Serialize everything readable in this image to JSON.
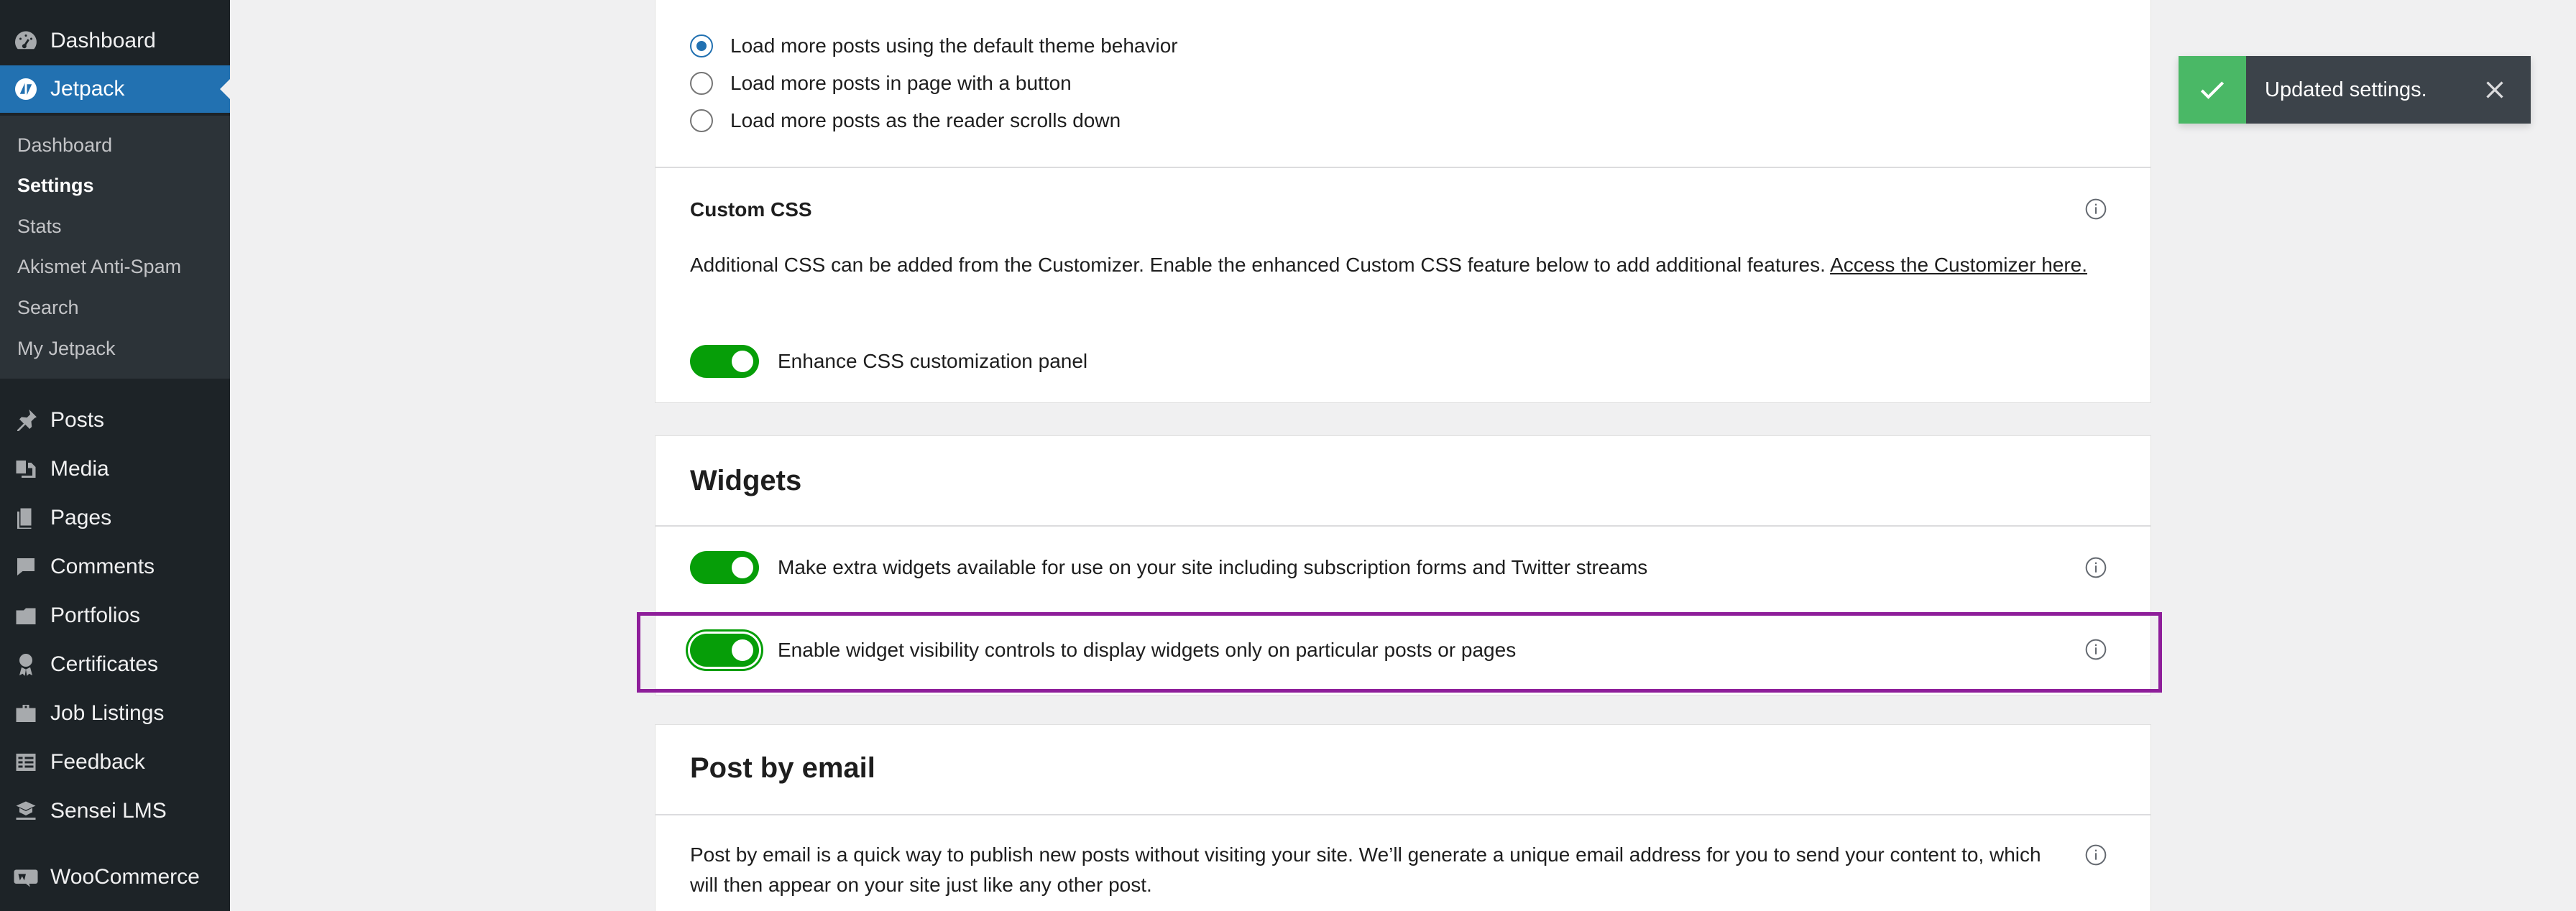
{
  "sidebar": {
    "top_items": [
      {
        "label": "Dashboard",
        "icon": "dashboard-icon"
      },
      {
        "label": "Jetpack",
        "icon": "jetpack-icon"
      }
    ],
    "jetpack_submenu": [
      "Dashboard",
      "Settings",
      "Stats",
      "Akismet Anti-Spam",
      "Search",
      "My Jetpack"
    ],
    "current_submenu": "Settings",
    "items": [
      {
        "label": "Posts",
        "icon": "pin-icon"
      },
      {
        "label": "Media",
        "icon": "media-icon"
      },
      {
        "label": "Pages",
        "icon": "pages-icon"
      },
      {
        "label": "Comments",
        "icon": "comments-icon"
      },
      {
        "label": "Portfolios",
        "icon": "portfolio-icon"
      },
      {
        "label": "Certificates",
        "icon": "certificate-icon"
      },
      {
        "label": "Job Listings",
        "icon": "briefcase-icon"
      },
      {
        "label": "Feedback",
        "icon": "feedback-icon"
      },
      {
        "label": "Sensei LMS",
        "icon": "sensei-icon"
      },
      {
        "label": "WooCommerce",
        "icon": "woocommerce-icon"
      }
    ]
  },
  "infinite_scroll": {
    "options": [
      {
        "label": "Load more posts using the default theme behavior",
        "checked": true
      },
      {
        "label": "Load more posts in page with a button",
        "checked": false
      },
      {
        "label": "Load more posts as the reader scrolls down",
        "checked": false
      }
    ]
  },
  "custom_css": {
    "heading": "Custom CSS",
    "description": "Additional CSS can be added from the Customizer. Enable the enhanced Custom CSS feature below to add additional features.",
    "link_text": "Access the Customizer here.",
    "toggle_label": "Enhance CSS customization panel",
    "toggle_on": true
  },
  "widgets": {
    "title": "Widgets",
    "extra_widgets_label": "Make extra widgets available for use on your site including subscription forms and Twitter streams",
    "extra_widgets_on": true,
    "visibility_label": "Enable widget visibility controls to display widgets only on particular posts or pages",
    "visibility_on": true
  },
  "post_by_email": {
    "title": "Post by email",
    "description": "Post by email is a quick way to publish new posts without visiting your site. We’ll generate a unique email address for you to send your content to, which will then appear on your site just like any other post."
  },
  "notice": {
    "message": "Updated settings."
  },
  "colors": {
    "sidebar_bg": "#1d2327",
    "accent": "#2271b1",
    "toggle_on": "#069e08",
    "highlight": "#8e1e9a",
    "notice_success": "#4ab866"
  }
}
